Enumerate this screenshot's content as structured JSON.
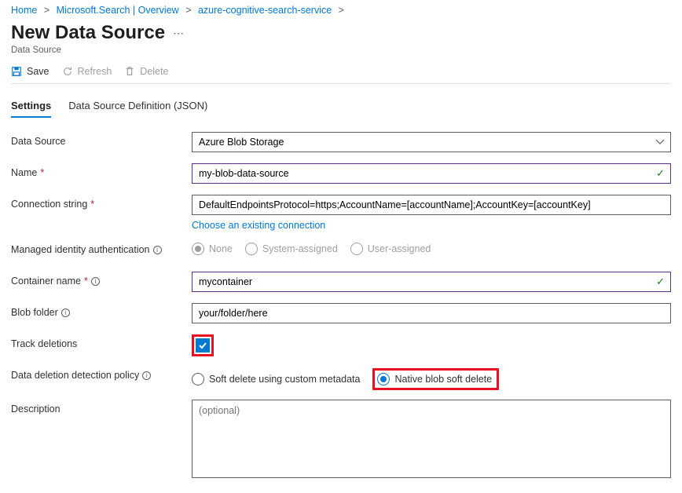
{
  "breadcrumb": {
    "home": "Home",
    "mssearch": "Microsoft.Search | Overview",
    "service": "azure-cognitive-search-service"
  },
  "page": {
    "title": "New Data Source",
    "subtitle": "Data Source"
  },
  "toolbar": {
    "save": "Save",
    "refresh": "Refresh",
    "delete": "Delete"
  },
  "tabs": {
    "settings": "Settings",
    "json": "Data Source Definition (JSON)"
  },
  "form": {
    "dataSource": {
      "label": "Data Source",
      "value": "Azure Blob Storage"
    },
    "name": {
      "label": "Name",
      "value": "my-blob-data-source"
    },
    "connection": {
      "label": "Connection string",
      "value": "DefaultEndpointsProtocol=https;AccountName=[accountName];AccountKey=[accountKey]",
      "link": "Choose an existing connection"
    },
    "identity": {
      "label": "Managed identity authentication",
      "none": "None",
      "system": "System-assigned",
      "user": "User-assigned"
    },
    "container": {
      "label": "Container name",
      "value": "mycontainer"
    },
    "folder": {
      "label": "Blob folder",
      "value": "your/folder/here"
    },
    "track": {
      "label": "Track deletions"
    },
    "policy": {
      "label": "Data deletion detection policy",
      "soft": "Soft delete using custom metadata",
      "native": "Native blob soft delete"
    },
    "description": {
      "label": "Description",
      "placeholder": "(optional)"
    }
  }
}
